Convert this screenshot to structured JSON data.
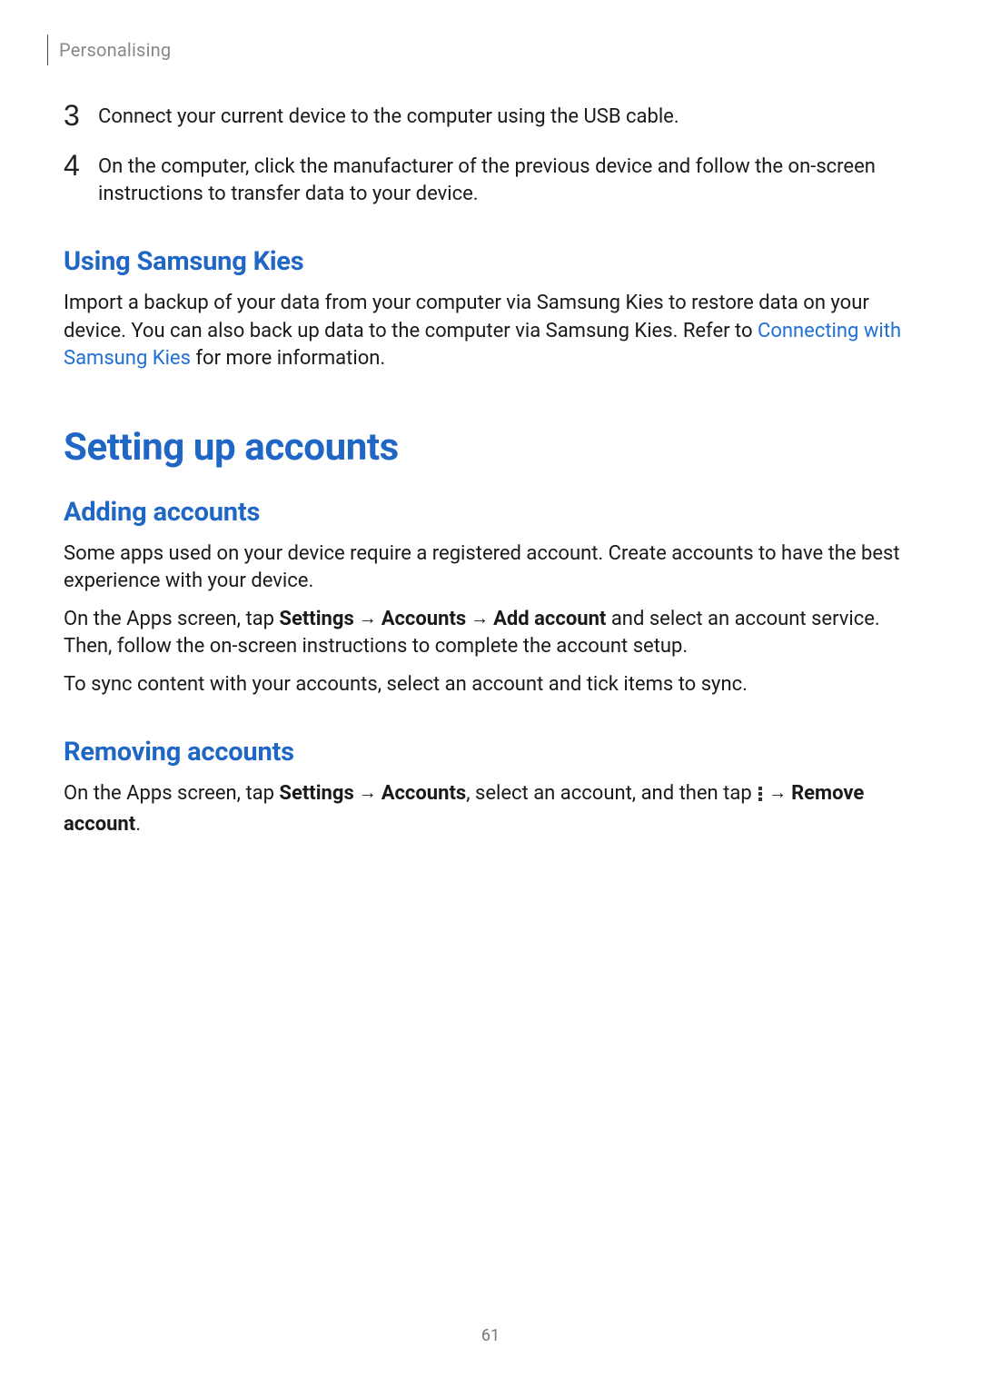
{
  "header": {
    "section": "Personalising"
  },
  "steps": [
    {
      "number": "3",
      "text": "Connect your current device to the computer using the USB cable."
    },
    {
      "number": "4",
      "text": "On the computer, click the manufacturer of the previous device and follow the on-screen instructions to transfer data to your device."
    }
  ],
  "kies": {
    "heading": "Using Samsung Kies",
    "body_a": "Import a backup of your data from your computer via Samsung Kies to restore data on your device. You can also back up data to the computer via Samsung Kies. Refer to ",
    "link": "Connecting with Samsung Kies",
    "body_b": " for more information."
  },
  "accounts": {
    "h1": "Setting up accounts",
    "adding": {
      "heading": "Adding accounts",
      "p1": "Some apps used on your device require a registered account. Create accounts to have the best experience with your device.",
      "p2_a": "On the Apps screen, tap ",
      "p2_settings": "Settings",
      "p2_arrow1": " → ",
      "p2_accounts": "Accounts",
      "p2_arrow2": " → ",
      "p2_addaccount": "Add account",
      "p2_b": " and select an account service. Then, follow the on-screen instructions to complete the account setup.",
      "p3": "To sync content with your accounts, select an account and tick items to sync."
    },
    "removing": {
      "heading": "Removing accounts",
      "p_a": "On the Apps screen, tap ",
      "p_settings": "Settings",
      "p_arrow1": " → ",
      "p_accounts": "Accounts",
      "p_b": ", select an account, and then tap ",
      "p_arrow2": " → ",
      "p_remove": "Remove account",
      "p_c": "."
    }
  },
  "page_number": "61"
}
